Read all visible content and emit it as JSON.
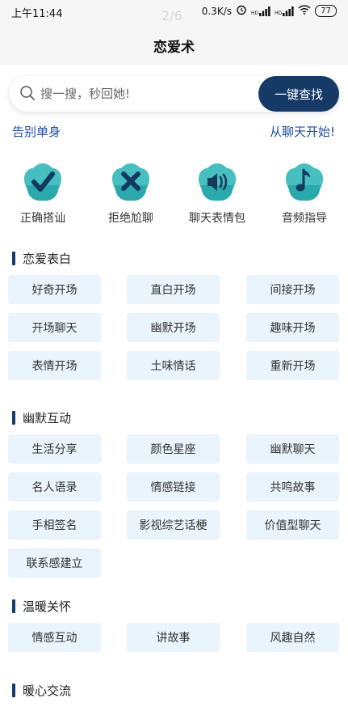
{
  "status": {
    "time": "上午11:44",
    "page_indicator": "2/6",
    "net_speed": "0.3K/s",
    "signal1": "HD",
    "signal2": "HD",
    "battery": "77"
  },
  "nav": {
    "title": "恋爱术"
  },
  "search": {
    "placeholder": "搜一搜，秒回她!",
    "button": "一键查找"
  },
  "taglines": {
    "left": "告别单身",
    "right": "从聊天开始!"
  },
  "features": [
    {
      "label": "正确搭讪",
      "icon": "check-icon"
    },
    {
      "label": "拒绝尬聊",
      "icon": "cross-icon"
    },
    {
      "label": "聊天表情包",
      "icon": "speaker-icon"
    },
    {
      "label": "音频指导",
      "icon": "music-note-icon"
    }
  ],
  "sections": [
    {
      "title": "恋爱表白",
      "items": [
        "好奇开场",
        "直白开场",
        "间接开场",
        "开场聊天",
        "幽默开场",
        "趣味开场",
        "表情开场",
        "土味情话",
        "重新开场"
      ]
    },
    {
      "title": "幽默互动",
      "items": [
        "生活分享",
        "颜色星座",
        "幽默聊天",
        "名人语录",
        "情感链接",
        "共鸣故事",
        "手相签名",
        "影视综艺话梗",
        "价值型聊天",
        "联系感建立"
      ]
    },
    {
      "title": "温暖关怀",
      "items": [
        "情感互动",
        "讲故事",
        "风趣自然"
      ]
    },
    {
      "title": "暖心交流",
      "items": []
    }
  ],
  "colors": {
    "accent": "#153a66",
    "chip_bg": "#e9f4fd",
    "tagline": "#1f4ea0",
    "icon_teal": "#35b5b8"
  }
}
